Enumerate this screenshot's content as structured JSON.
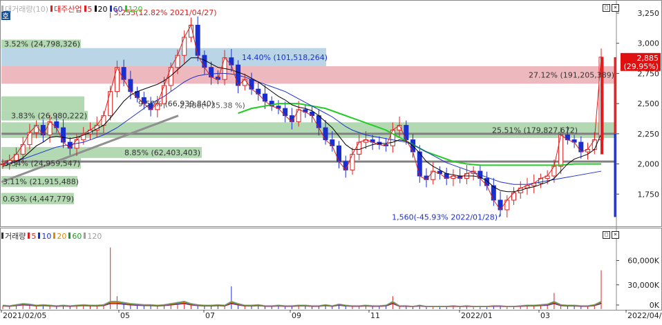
{
  "price_panel": {
    "legend": [
      {
        "label": "대거래량(10)",
        "color": "#b0b0b0"
      },
      {
        "label": "대주산업",
        "color": "#e02020"
      },
      {
        "label": "5",
        "color": "#e02020"
      },
      {
        "label": "20",
        "color": "#000000"
      },
      {
        "label": "60",
        "color": "#1a2fd0"
      },
      {
        "label": "120",
        "color": "#22cc22"
      }
    ],
    "side_icon": "호",
    "axis_ticks": [
      "3,250",
      "3,000",
      "2,750",
      "2,500",
      "2,250",
      "2,000",
      "1,750"
    ],
    "max_annotation": "3,255(12.82% 2021/04/27)",
    "min_annotation": "1,560(-45.93% 2022/01/28)",
    "trend_annotation": "2,486(+35.38 %)",
    "current_price": "2,885",
    "current_change": "(29.95%)"
  },
  "volume_panel": {
    "legend": [
      {
        "label": "거래량",
        "color": "#333333"
      },
      {
        "label": "5",
        "color": "#e02020"
      },
      {
        "label": "10",
        "color": "#1a2fd0"
      },
      {
        "label": "20",
        "color": "#e08a00"
      },
      {
        "label": "60",
        "color": "#229922"
      },
      {
        "label": "120",
        "color": "#a0a0a0"
      }
    ],
    "axis_ticks": [
      "60,000K",
      "30,000K",
      "0K"
    ]
  },
  "x_axis": [
    "2021/02/05",
    "05",
    "07",
    "09",
    "11",
    "2022/01",
    "03",
    "2022/04/25"
  ],
  "chart_data": {
    "type": "candlestick",
    "title": "대주산업",
    "y_range": [
      1500,
      3330
    ],
    "price_levels": [
      {
        "label": "3.52% (24,798,326)",
        "low": 2960,
        "high": 3030,
        "color": "#9fcf9f"
      },
      {
        "label": "14.40% (101,518,264)",
        "low": 2810,
        "high": 2960,
        "color": "#a8cbe0"
      },
      {
        "label": "27.12% (191,205,389)",
        "low": 2665,
        "high": 2810,
        "color": "#e8a8ae"
      },
      {
        "label": "3.83% (26,980,222)",
        "low": 2360,
        "high": 2440,
        "color": "#9fcf9f"
      },
      {
        "label": "9.50% (66,939,840)",
        "low": 2440,
        "high": 2560,
        "color": "#9fcf9f"
      },
      {
        "label": "25.51% (179,827,672)",
        "low": 2215,
        "high": 2345,
        "color": "#9fcf9f"
      },
      {
        "label": "8.85% (62,403,403)",
        "low": 2050,
        "high": 2140,
        "color": "#9fcf9f"
      },
      {
        "label": "3.54% (24,959,547)",
        "low": 1960,
        "high": 2050,
        "color": "#9fcf9f"
      },
      {
        "label": "3.11% (21,915,488)",
        "low": 1810,
        "high": 1900,
        "color": "#9fcf9f"
      },
      {
        "label": "0.63% (4,447,779)",
        "low": 1665,
        "high": 1760,
        "color": "#9fcf9f"
      }
    ],
    "support_lines": [
      2250,
      2020
    ],
    "price_path": [
      2000,
      2030,
      2080,
      2160,
      2260,
      2320,
      2240,
      2350,
      2300,
      2180,
      2130,
      2200,
      2250,
      2280,
      2320,
      2400,
      2600,
      2800,
      2700,
      2600,
      2550,
      2500,
      2450,
      2500,
      2650,
      2800,
      2900,
      3050,
      3150,
      2900,
      2800,
      2720,
      2700,
      2880,
      2820,
      2650,
      2700,
      2620,
      2580,
      2520,
      2480,
      2460,
      2400,
      2350,
      2450,
      2430,
      2400,
      2300,
      2200,
      2150,
      2020,
      1950,
      2080,
      2180,
      2200,
      2180,
      2160,
      2150,
      2280,
      2320,
      2200,
      2100,
      1900,
      1870,
      1940,
      1920,
      1880,
      1900,
      1880,
      1920,
      1940,
      1880,
      1820,
      1700,
      1620,
      1700,
      1760,
      1800,
      1820,
      1840,
      1880,
      1900,
      1980,
      2240,
      2200,
      2180,
      2100,
      2120,
      2200,
      2885
    ],
    "ma20_path": [
      1980,
      2000,
      2020,
      2050,
      2100,
      2150,
      2180,
      2220,
      2230,
      2220,
      2210,
      2220,
      2240,
      2260,
      2290,
      2320,
      2380,
      2450,
      2520,
      2570,
      2600,
      2620,
      2640,
      2660,
      2690,
      2730,
      2780,
      2830,
      2880,
      2880,
      2860,
      2830,
      2800,
      2790,
      2780,
      2760,
      2740,
      2710,
      2680,
      2640,
      2600,
      2560,
      2530,
      2490,
      2470,
      2460,
      2440,
      2400,
      2350,
      2300,
      2230,
      2160,
      2120,
      2120,
      2140,
      2160,
      2170,
      2170,
      2180,
      2200,
      2190,
      2150,
      2090,
      2020,
      1980,
      1950,
      1920,
      1910,
      1900,
      1900,
      1900,
      1890,
      1860,
      1810,
      1780,
      1770,
      1770,
      1780,
      1800,
      1810,
      1830,
      1850,
      1880,
      1940,
      2000,
      2040,
      2060,
      2080,
      2120,
      2250
    ],
    "ma60_path": [
      2000,
      2010,
      2020,
      2040,
      2060,
      2080,
      2100,
      2120,
      2140,
      2150,
      2160,
      2170,
      2180,
      2200,
      2220,
      2240,
      2270,
      2300,
      2340,
      2380,
      2420,
      2460,
      2500,
      2530,
      2560,
      2600,
      2640,
      2680,
      2710,
      2730,
      2740,
      2745,
      2750,
      2750,
      2745,
      2735,
      2720,
      2700,
      2680,
      2660,
      2640,
      2620,
      2600,
      2570,
      2540,
      2510,
      2480,
      2450,
      2420,
      2390,
      2350,
      2310,
      2280,
      2260,
      2240,
      2230,
      2220,
      2210,
      2200,
      2190,
      2180,
      2160,
      2130,
      2100,
      2070,
      2040,
      2010,
      1990,
      1970,
      1950,
      1930,
      1910,
      1890,
      1870,
      1850,
      1840,
      1830,
      1830,
      1830,
      1840,
      1850,
      1860,
      1870,
      1880,
      1890,
      1900,
      1910,
      1920,
      1930,
      1940
    ],
    "ma120_path": [
      null,
      null,
      null,
      null,
      null,
      null,
      null,
      null,
      null,
      null,
      null,
      null,
      null,
      null,
      null,
      null,
      null,
      null,
      null,
      null,
      null,
      null,
      null,
      null,
      null,
      null,
      null,
      null,
      null,
      null,
      null,
      null,
      null,
      null,
      null,
      2420,
      2440,
      2460,
      2470,
      2480,
      2490,
      2500,
      2500,
      2500,
      2500,
      2490,
      2480,
      2470,
      2460,
      2440,
      2420,
      2400,
      2380,
      2360,
      2340,
      2320,
      2300,
      2280,
      2250,
      2220,
      2190,
      2160,
      2130,
      2100,
      2080,
      2060,
      2040,
      2020,
      2010,
      2000,
      1995,
      1990,
      1990,
      1990,
      1990,
      1990,
      1990,
      1990,
      1990,
      1990,
      1990,
      1990,
      1990,
      1990,
      1995,
      2000,
      2000,
      2000,
      2000,
      2000
    ],
    "volume_path": [
      0.05,
      0.04,
      0.06,
      0.08,
      0.07,
      0.05,
      0.06,
      0.05,
      0.04,
      0.05,
      0.04,
      0.05,
      0.06,
      0.05,
      0.05,
      0.06,
      0.95,
      0.2,
      0.1,
      0.08,
      0.07,
      0.06,
      0.06,
      0.05,
      0.06,
      0.08,
      0.1,
      0.12,
      0.08,
      0.06,
      0.05,
      0.05,
      0.06,
      0.05,
      0.35,
      0.08,
      0.05,
      0.05,
      0.06,
      0.04,
      0.04,
      0.05,
      0.04,
      0.04,
      0.05,
      0.05,
      0.04,
      0.04,
      0.06,
      0.04,
      0.07,
      0.05,
      0.04,
      0.04,
      0.05,
      0.04,
      0.04,
      0.05,
      0.2,
      0.04,
      0.04,
      0.03,
      0.05,
      0.03,
      0.03,
      0.03,
      0.03,
      0.04,
      0.03,
      0.04,
      0.03,
      0.03,
      0.03,
      0.04,
      0.04,
      0.03,
      0.03,
      0.04,
      0.05,
      0.05,
      0.06,
      0.07,
      0.25,
      0.06,
      0.05,
      0.05,
      0.04,
      0.04,
      0.06,
      0.6
    ]
  }
}
